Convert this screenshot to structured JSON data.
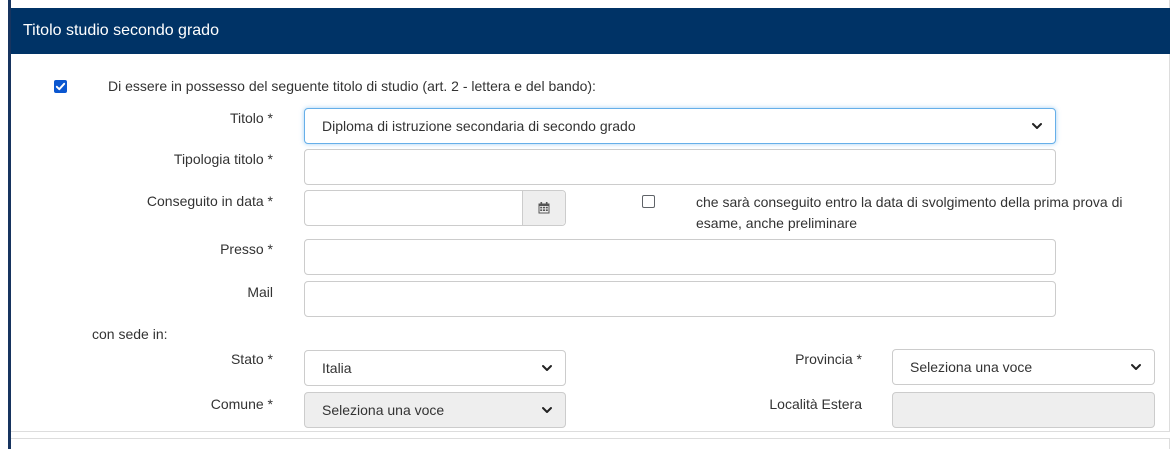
{
  "section": {
    "title": "Titolo studio secondo grado"
  },
  "possesso": {
    "checked": true,
    "text": "Di essere in possesso del seguente titolo di studio (art. 2 - lettera e del bando):"
  },
  "fields": {
    "titolo": {
      "label": "Titolo *",
      "value": "Diploma di istruzione secondaria di secondo grado"
    },
    "tipologia": {
      "label": "Tipologia titolo *",
      "value": ""
    },
    "conseguito": {
      "label": "Conseguito in data *",
      "value": "",
      "icon": "calendar-icon"
    },
    "entro_data": {
      "checked": false,
      "text_line1": "che sarà conseguito entro la data di svolgimento della prima prova di",
      "text_line2": "esame, anche preliminare"
    },
    "presso": {
      "label": "Presso *",
      "value": ""
    },
    "mail": {
      "label": "Mail",
      "value": ""
    }
  },
  "sede": {
    "heading": "con sede in:",
    "stato": {
      "label": "Stato *",
      "value": "Italia"
    },
    "provincia": {
      "label": "Provincia *",
      "value": "Seleziona una voce"
    },
    "comune": {
      "label": "Comune *",
      "value": "Seleziona una voce"
    },
    "localita": {
      "label": "Località Estera",
      "value": ""
    }
  },
  "colors": {
    "header_bg": "#003366",
    "accent_checkbox": "#0b57d0",
    "focus_border": "#66afe9",
    "disabled_bg": "#eeeeee"
  }
}
